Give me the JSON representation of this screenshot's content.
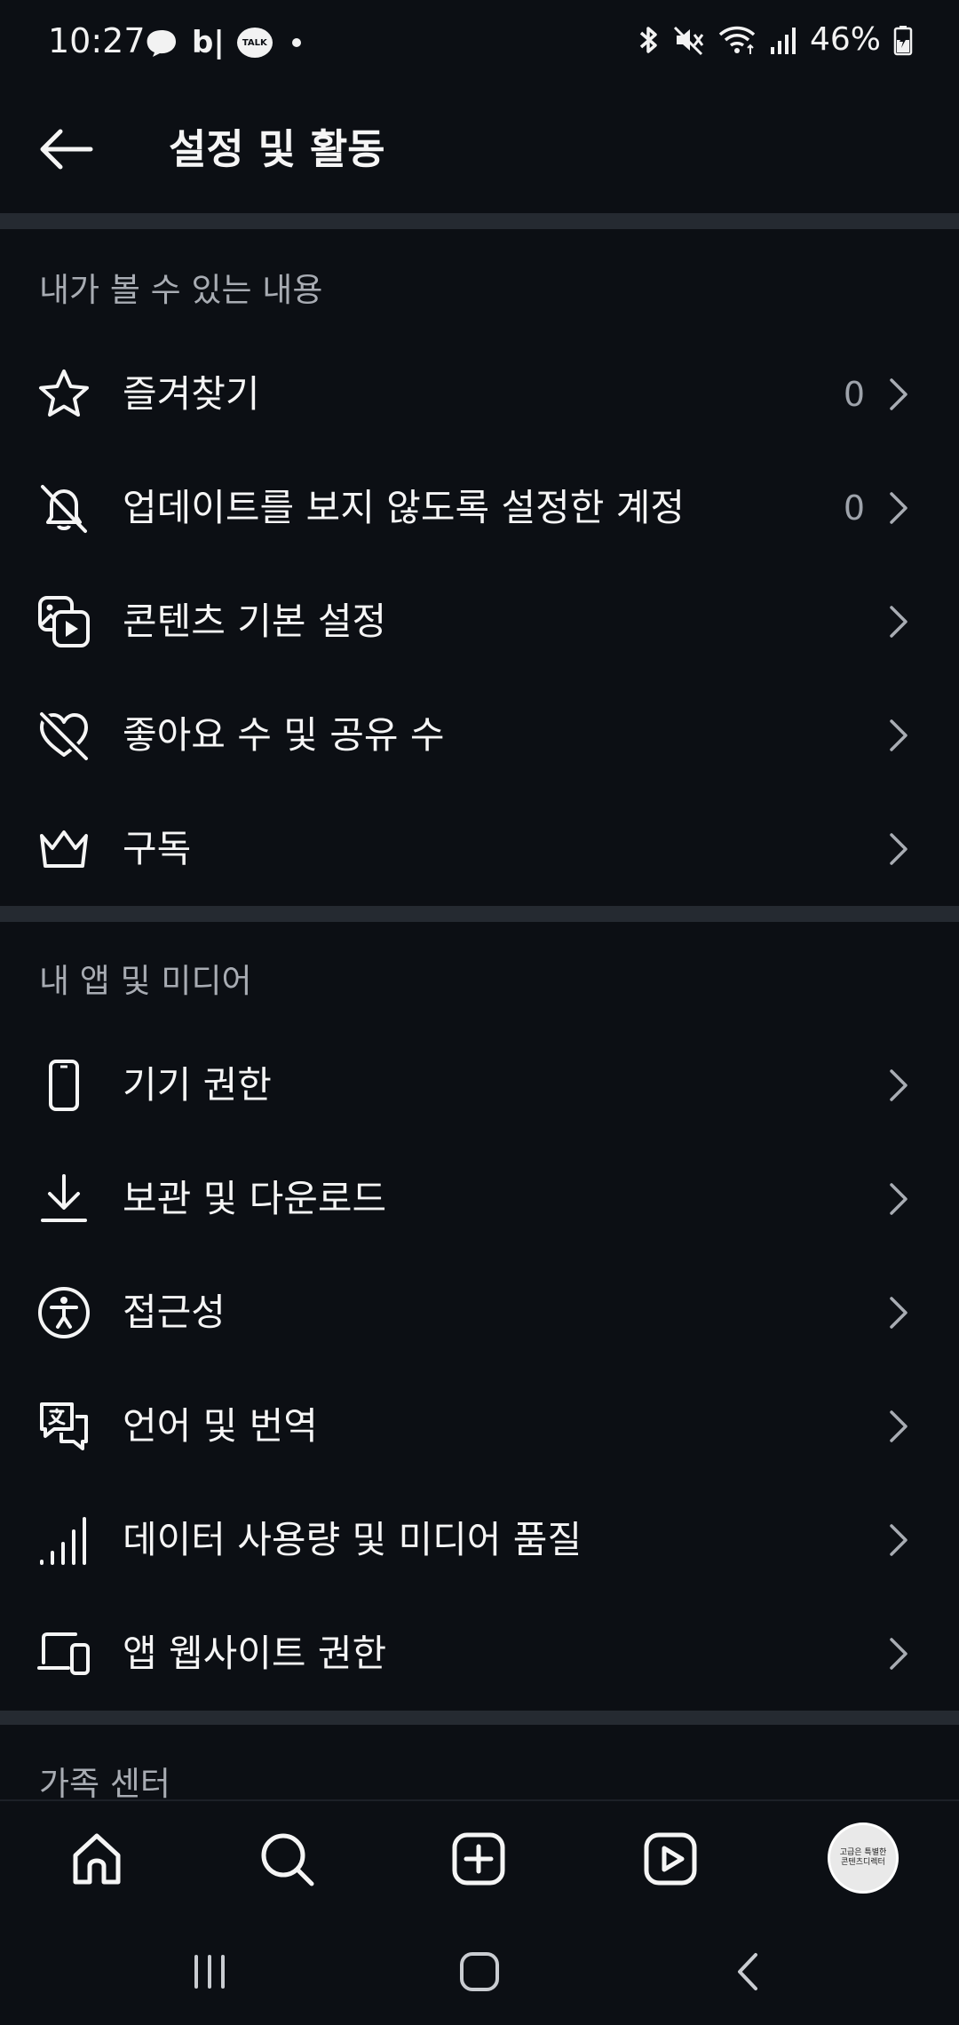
{
  "status_bar": {
    "time": "10:27",
    "left_icons": [
      "thread-chat-icon",
      "blog-b-icon",
      "kakaotalk-icon",
      "notification-dot-icon"
    ],
    "kakao_label": "TALK",
    "blog_label": "b|",
    "right_icons": [
      "bluetooth-icon",
      "mute-icon",
      "wifi-icon",
      "signal-icon",
      "battery-icon"
    ],
    "battery": "46%"
  },
  "header": {
    "title": "설정 및 활동"
  },
  "sections": [
    {
      "title": "내가 볼 수 있는 내용",
      "items": [
        {
          "label": "즐겨찾기",
          "count": "0",
          "icon": "star-icon"
        },
        {
          "label": "업데이트를 보지 않도록 설정한 계정",
          "count": "0",
          "icon": "bell-off-icon"
        },
        {
          "label": "콘텐츠 기본 설정",
          "count": "",
          "icon": "media-icon"
        },
        {
          "label": "좋아요 수 및 공유 수",
          "count": "",
          "icon": "heart-off-icon"
        },
        {
          "label": "구독",
          "count": "",
          "icon": "crown-icon"
        }
      ]
    },
    {
      "title": "내 앱 및 미디어",
      "items": [
        {
          "label": "기기 권한",
          "icon": "phone-icon"
        },
        {
          "label": "보관 및 다운로드",
          "icon": "download-icon"
        },
        {
          "label": "접근성",
          "icon": "accessibility-icon"
        },
        {
          "label": "언어 및 번역",
          "icon": "translate-icon"
        },
        {
          "label": "데이터 사용량 및 미디어 품질",
          "icon": "signal-bars-icon"
        },
        {
          "label": "앱 웹사이트 권한",
          "icon": "devices-icon"
        }
      ]
    },
    {
      "title": "가족 센터"
    }
  ],
  "bottom_nav": {
    "items": [
      "home-icon",
      "search-icon",
      "create-icon",
      "reels-icon",
      "profile-avatar"
    ],
    "avatar_text_line1": "고급은 특별한",
    "avatar_text_line2": "콘텐츠디렉터"
  },
  "system_nav": {
    "items": [
      "recent-apps-icon",
      "home-button-icon",
      "back-button-icon"
    ]
  },
  "colors": {
    "background": "#0c0f14",
    "divider": "#252a31",
    "text": "#f5f5f5",
    "muted": "#a8acb3"
  }
}
